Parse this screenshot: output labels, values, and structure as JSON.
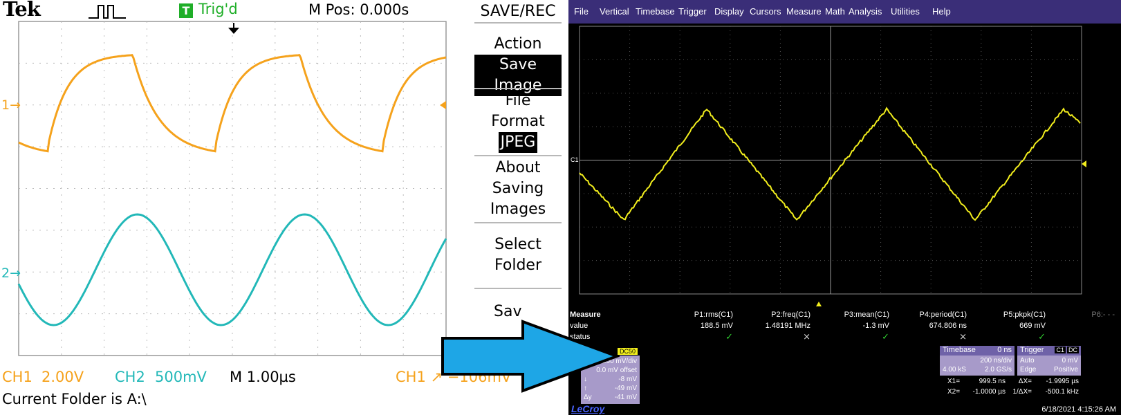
{
  "tek": {
    "logo": "Tek",
    "trigger_icon": "T",
    "trigger_status": "Trig'd",
    "m_pos": "M Pos: 0.000s",
    "menu_title": "SAVE/REC",
    "menu": {
      "action_label": "Action",
      "action_value": "Save Image",
      "file_format_line1": "File",
      "file_format_line2": "Format",
      "file_format_value": "JPEG",
      "about_line1": "About",
      "about_line2": "Saving",
      "about_line3": "Images",
      "select_line1": "Select",
      "select_line2": "Folder",
      "save_partial": "Sav"
    },
    "ch1_marker": "1",
    "ch2_marker": "2",
    "status": {
      "ch1": "CH1",
      "ch1_scale": "2.00V",
      "ch2": "CH2",
      "ch2_scale": "500mV",
      "timebase": "M 1.00µs",
      "trigger": "CH1 ↗ −106mV"
    },
    "current_folder": "Current Folder is A:\\",
    "colors": {
      "ch1": "#f5a21c",
      "ch2": "#22b8b8",
      "trig": "#1fae28"
    }
  },
  "lecroy": {
    "menus": [
      "File",
      "Vertical",
      "Timebase",
      "Trigger",
      "Display",
      "Cursors",
      "Measure",
      "Math",
      "Analysis",
      "Utilities",
      "Help"
    ],
    "c1_marker": "C1",
    "measure": {
      "title": "Measure",
      "row_value": "value",
      "row_status": "status",
      "params": [
        {
          "name": "P1:rms(C1)",
          "value": "188.5 mV",
          "status": "✓"
        },
        {
          "name": "P2:freq(C1)",
          "value": "1.48191 MHz",
          "status": "⨯"
        },
        {
          "name": "P3:mean(C1)",
          "value": "-1.3 mV",
          "status": "✓"
        },
        {
          "name": "P4:period(C1)",
          "value": "674.806 ns",
          "status": "⨯"
        },
        {
          "name": "P5:pkpk(C1)",
          "value": "669 mV",
          "status": "✓"
        },
        {
          "name": "P6:- - -",
          "value": "",
          "status": ""
        }
      ]
    },
    "c1_descriptor": {
      "coupling": "DC50",
      "scale": "200 mV/div",
      "offset": "0.0 mV offset",
      "r1_sym": "↓",
      "r1_val": "-8 mV",
      "r2_sym": "↑",
      "r2_val": "-49 mV",
      "r3_sym": "Δy",
      "r3_val": "-41 mV"
    },
    "timebase": {
      "label": "Timebase",
      "delay": "0 ns",
      "per_div": "200 ns/div",
      "samples": "4.00 kS",
      "rate": "2.0 GS/s"
    },
    "trigger": {
      "label": "Trigger",
      "source": "C1",
      "coupling": "DC",
      "mode": "Auto",
      "level": "0 mV",
      "type": "Edge",
      "slope": "Positive"
    },
    "cursors": {
      "x1_label": "X1=",
      "x1": "999.5 ns",
      "dx_label": "ΔX=",
      "dx": "-1.9995 µs",
      "x2_label": "X2=",
      "x2": "-1.0000 µs",
      "inv_label": "1/ΔX=",
      "inv": "-500.1 kHz"
    },
    "brand": "LeCroy",
    "datetime": "6/18/2021 4:15:26 AM",
    "colors": {
      "trace": "#f2ee1d",
      "menubar": "#3a2e78",
      "panel": "#a79ac9"
    }
  }
}
